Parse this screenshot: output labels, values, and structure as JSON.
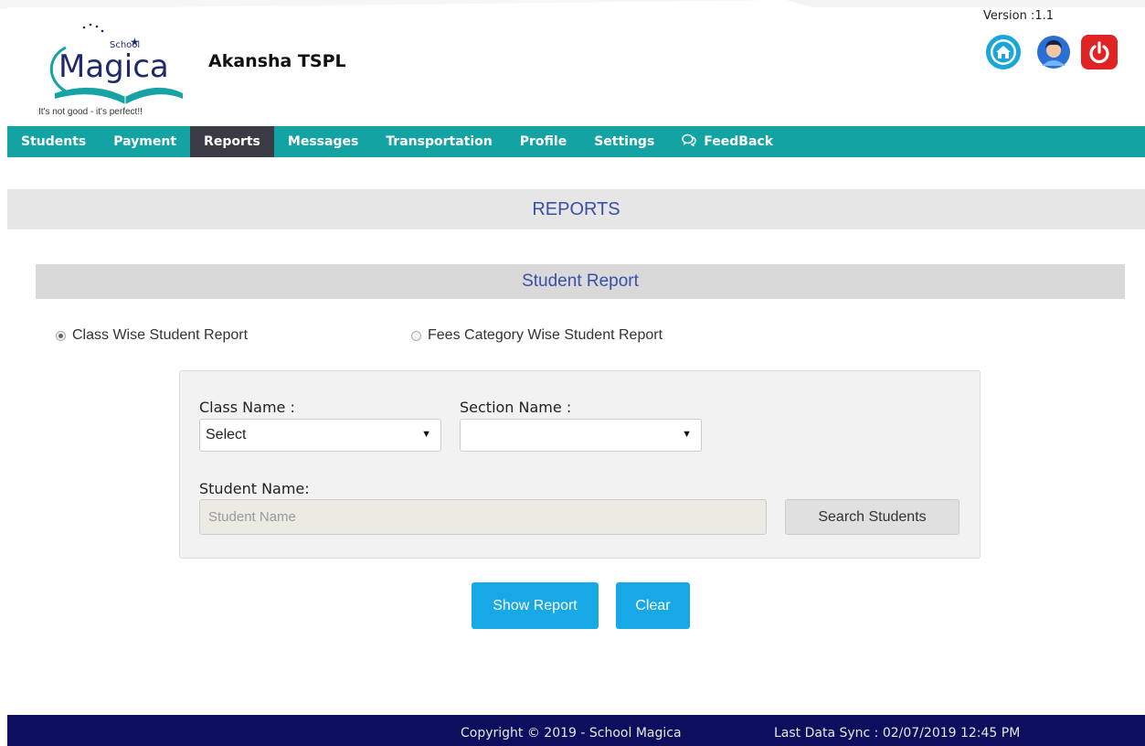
{
  "header": {
    "logo_brand": "Magica",
    "logo_badge": "School",
    "logo_tagline": "It's not good - it's perfect!!",
    "company_name": "Akansha TSPL",
    "version": "Version :1.1",
    "icons": [
      "home-icon",
      "user-avatar-icon",
      "power-icon"
    ]
  },
  "nav": {
    "items": [
      "Students",
      "Payment",
      "Reports",
      "Messages",
      "Transportation",
      "Profile",
      "Settings",
      "FeedBack"
    ],
    "active": "Reports"
  },
  "page": {
    "title": "REPORTS",
    "section_title": "Student Report"
  },
  "report_type": {
    "options": [
      "Class Wise Student Report",
      "Fees Category Wise Student Report"
    ],
    "selected": "Class Wise Student Report"
  },
  "filters": {
    "class_label": "Class Name :",
    "class_value": "Select",
    "section_label": "Section Name :",
    "section_value": "",
    "student_label": "Student Name:",
    "student_placeholder": "Student Name",
    "search_button": "Search Students"
  },
  "actions": {
    "show_report": "Show Report",
    "clear": "Clear"
  },
  "footer": {
    "copyright": "Copyright © 2019 - School Magica",
    "last_sync": "Last Data Sync : 02/07/2019 12:45 PM"
  },
  "colors": {
    "nav_bg": "#14a3a3",
    "nav_active": "#3b3b45",
    "title_text": "#3a4fa7",
    "primary_button": "#17a8e6",
    "footer_bg": "#0c0f5e"
  }
}
